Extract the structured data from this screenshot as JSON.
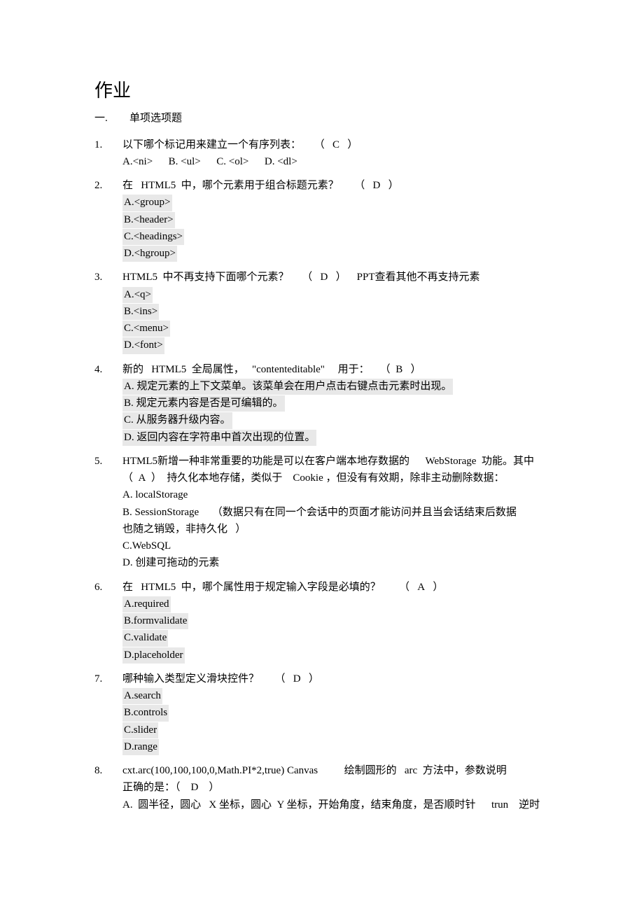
{
  "title": "作业",
  "section": {
    "num": "一.",
    "label": "单项选项题"
  },
  "q1": {
    "num": "1.",
    "stem_a": "以下哪个标记用来建立一个有序列表：",
    "paren_l": "（",
    "ans": "C",
    "paren_r": "）",
    "optA": "A.<ni>",
    "optB": "B. <ul>",
    "optC": "C. <ol>",
    "optD": "D. <dl>"
  },
  "q2": {
    "num": "2.",
    "stem_a": "在",
    "stem_b": "HTML5",
    "stem_c": "中，哪个元素用于组合标题元素？",
    "paren_l": "（",
    "ans": "D",
    "paren_r": "）",
    "A": "A.<group>",
    "B": "B.<header>",
    "C": "C.<headings>",
    "D": "D.<hgroup>"
  },
  "q3": {
    "num": "3.",
    "stem_a": "HTML5",
    "stem_b": "中不再支持下面哪个元素？",
    "paren_l": "（",
    "ans": "D",
    "paren_r": "）",
    "note": "PPT查看其他不再支持元素",
    "A": "A.<q>",
    "B": "B.<ins>",
    "C": "C.<menu>",
    "D": "D.<font>"
  },
  "q4": {
    "num": "4.",
    "stem_a": "新的",
    "stem_b": "HTML5",
    "stem_c": "全局属性，",
    "stem_d": "\"contenteditable\"",
    "stem_e": "用于：",
    "paren_l": "（",
    "ans": "B",
    "paren_r": "）",
    "A": "A. 规定元素的上下文菜单。该菜单会在用户点击右键点击元素时出现。",
    "B": "B. 规定元素内容是否是可编辑的。",
    "C": "C. 从服务器升级内容。",
    "D": "D. 返回内容在字符串中首次出现的位置。"
  },
  "q5": {
    "num": "5.",
    "stem_a": "HTML5新增一种非常重要的功能是可以在客户端本地存数据的",
    "stem_b": "WebStorage",
    "stem_c": "功能。其中",
    "paren_l": "（",
    "ans": "A",
    "paren_r": "）",
    "stem2a": "持久化本地存储，类似于",
    "stem2b": "Cookie",
    "stem2c": "，但没有有效期，除非主动删除数据：",
    "A": "A. localStorage",
    "B_a": "B. SessionStorage",
    "B_b": "（数据只有在同一个会话中的页面才能访问并且当会话结束后数据",
    "B_c": "也随之销毁，非持久化",
    "B_d": "）",
    "C": "C.WebSQL",
    "D": "D. 创建可拖动的元素"
  },
  "q6": {
    "num": "6.",
    "stem_a": "在",
    "stem_b": "HTML5",
    "stem_c": "中，哪个属性用于规定输入字段是必填的？",
    "paren_l": "（",
    "ans": "A",
    "paren_r": "）",
    "A": "A.required",
    "B": "B.formvalidate",
    "C": "C.validate",
    "D": "D.placeholder"
  },
  "q7": {
    "num": "7.",
    "stem_a": "哪种输入类型定义滑块控件？",
    "paren_l": "（",
    "ans": "D",
    "paren_r": "）",
    "A": "A.search",
    "B": "B.controls",
    "C": "C.slider",
    "D": "D.range"
  },
  "q8": {
    "num": "8.",
    "stem_a": "cxt.arc(100,100,100,0,Math.PI*2,true) Canvas",
    "stem_b": "绘制圆形的",
    "stem_c": "arc",
    "stem_d": "方法中，参数说明",
    "stem2a": "正确的是：（",
    "ans": "D",
    "stem2c": "）",
    "A_a": "A.",
    "A_b": "圆半径，圆心",
    "A_c": "X 坐标，圆心",
    "A_d": "Y 坐标，开始角度，结束角度，是否顺时针",
    "A_e": "trun",
    "A_f": "逆时"
  }
}
